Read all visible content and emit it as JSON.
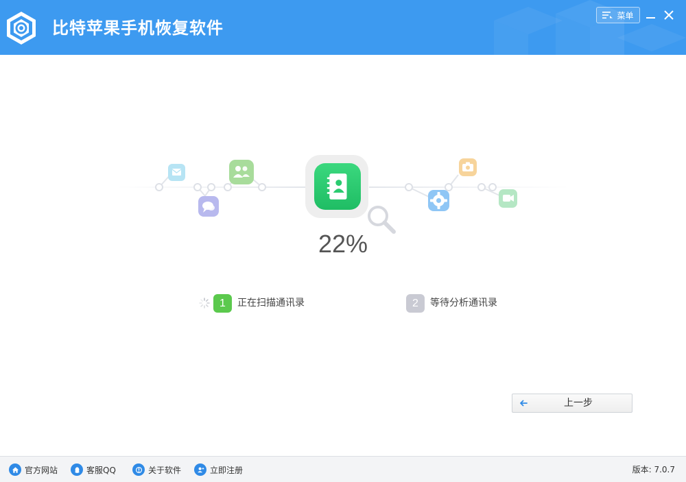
{
  "window": {
    "title": "比特苹果手机恢复软件",
    "menu_label": "菜单"
  },
  "scan": {
    "percent": "22%",
    "steps": [
      {
        "number": "1",
        "label": "正在扫描通讯录",
        "state": "active",
        "color": "#5bc94d"
      },
      {
        "number": "2",
        "label": "等待分析通讯录",
        "state": "waiting",
        "color": "#c9cad3"
      }
    ],
    "icons": [
      "mail-icon",
      "contacts-group-icon",
      "chat-icon",
      "address-book-icon",
      "settings-icon",
      "camera-icon",
      "video-icon",
      "magnifier-icon"
    ]
  },
  "actions": {
    "back_label": "上一步"
  },
  "footer": {
    "links": [
      {
        "label": "官方网站",
        "icon": "home-icon"
      },
      {
        "label": "客服QQ",
        "icon": "qq-icon"
      },
      {
        "label": "关于软件",
        "icon": "info-icon"
      },
      {
        "label": "立即注册",
        "icon": "user-add-icon"
      }
    ],
    "version": "版本: 7.0.7"
  },
  "colors": {
    "accent": "#3d9af0",
    "progress_active": "#5bc94d",
    "center_icon": "#2bcb70"
  }
}
